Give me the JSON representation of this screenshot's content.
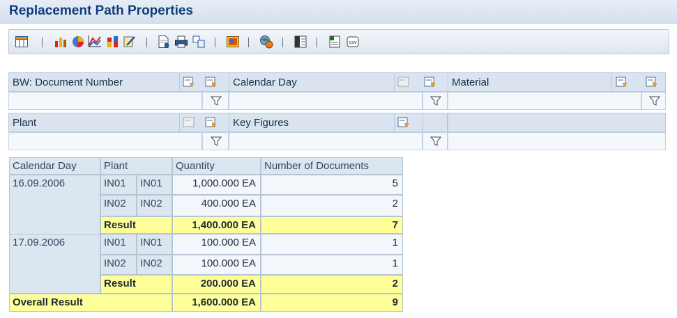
{
  "header": {
    "title": "Replacement Path Properties"
  },
  "toolbar": {
    "icons": [
      "table-icon",
      "bar-chart-icon",
      "pie-chart-icon",
      "line-chart-icon",
      "stacked-chart-icon",
      "edit-chart-icon",
      "document-icon",
      "print-icon",
      "layout-icon",
      "image-icon",
      "world-settings-icon",
      "columns-icon",
      "excel-export-icon",
      "csv-export-icon"
    ]
  },
  "navigation": {
    "characteristics": [
      {
        "label": "BW: Document Number"
      },
      {
        "label": "Calendar Day"
      },
      {
        "label": "Material"
      },
      {
        "label": "Plant"
      },
      {
        "label": "Key Figures"
      }
    ]
  },
  "table": {
    "columns": [
      "Calendar Day",
      "Plant",
      "Quantity",
      "Number of Documents"
    ],
    "groups": [
      {
        "day": "16.09.2006",
        "rows": [
          {
            "plant_key": "IN01",
            "plant_text": "IN01",
            "quantity": "1,000.000 EA",
            "docs": "5"
          },
          {
            "plant_key": "IN02",
            "plant_text": "IN02",
            "quantity": "400.000 EA",
            "docs": "2"
          }
        ],
        "result_label": "Result",
        "result_quantity": "1,400.000 EA",
        "result_docs": "7"
      },
      {
        "day": "17.09.2006",
        "rows": [
          {
            "plant_key": "IN01",
            "plant_text": "IN01",
            "quantity": "100.000 EA",
            "docs": "1"
          },
          {
            "plant_key": "IN02",
            "plant_text": "IN02",
            "quantity": "100.000 EA",
            "docs": "1"
          }
        ],
        "result_label": "Result",
        "result_quantity": "200.000 EA",
        "result_docs": "2"
      }
    ],
    "overall": {
      "label": "Overall Result",
      "quantity": "1,600.000 EA",
      "docs": "9"
    }
  },
  "colors": {
    "header_title": "#0f3d78",
    "result_highlight": "#ffff99",
    "header_cell": "#dce6f1"
  }
}
